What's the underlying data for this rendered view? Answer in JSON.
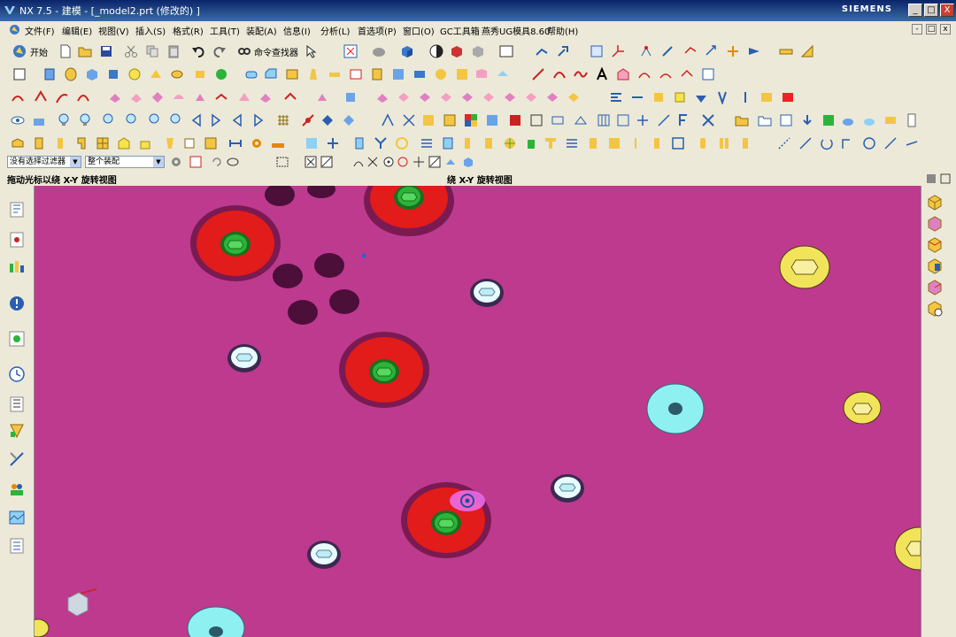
{
  "window": {
    "title": "NX 7.5 - 建模 - [_model2.prt (修改的) ]",
    "brand": "SIEMENS",
    "min_glyph": "_",
    "max_glyph": "□",
    "close_glyph": "X"
  },
  "menu": {
    "items": [
      "文件(F)",
      "编辑(E)",
      "视图(V)",
      "插入(S)",
      "格式(R)",
      "工具(T)",
      "装配(A)",
      "信息(I)",
      "分析(L)",
      "首选项(P)",
      "窗口(O)",
      "GC工具箱",
      "燕秀UG模具8.60",
      "帮助(H)"
    ],
    "mdi_min": "-",
    "mdi_max": "□",
    "mdi_close": "x"
  },
  "toolbar": {
    "start_label": "开始",
    "command_finder_label": "命令查找器"
  },
  "selection": {
    "filter_value": "没有选择过滤器",
    "scope_value": "整个装配"
  },
  "status": {
    "left": "拖动光标以绕 X-Y 旋转视图",
    "center": "绕 X-Y 旋转视图"
  },
  "colors": {
    "background": "#bd3a8e",
    "boss_red": "#e21b1b",
    "boss_green": "#2bb43a",
    "cyan_part": "#8ff0f2",
    "yellow_part": "#f2e45a",
    "hole": "#4c0f3a"
  }
}
